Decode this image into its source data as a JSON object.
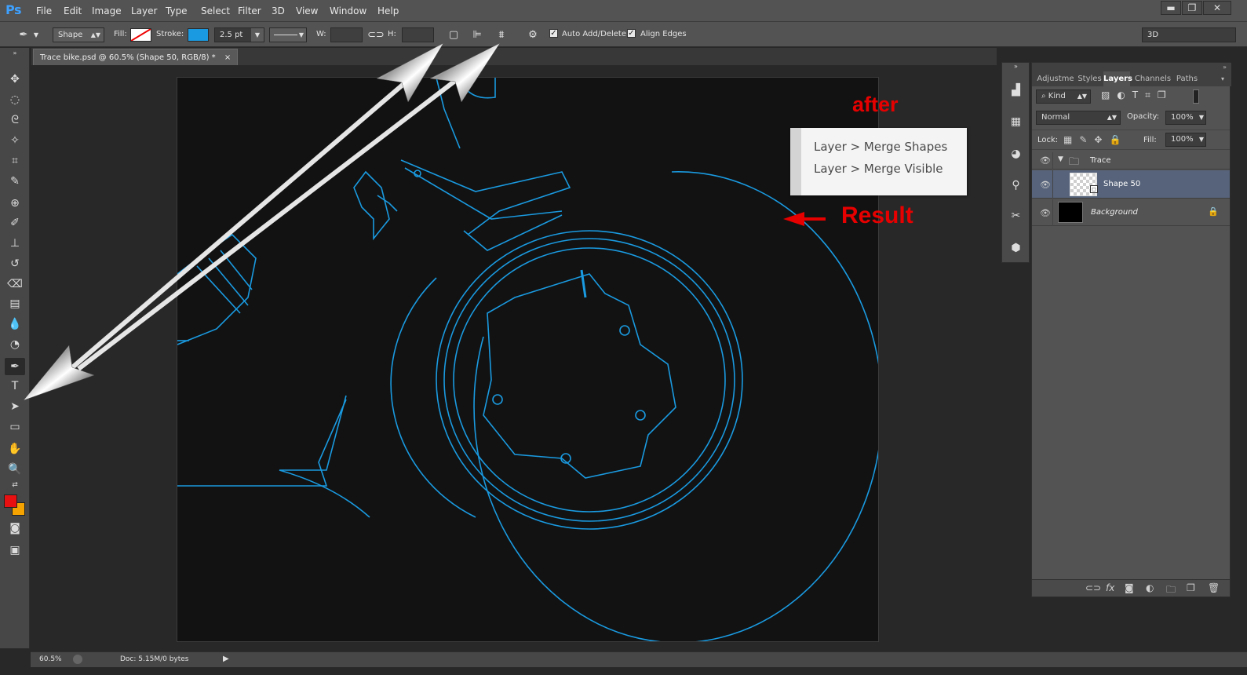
{
  "app": {
    "logo": "Ps"
  },
  "menu": [
    "File",
    "Edit",
    "Image",
    "Layer",
    "Type",
    "Select",
    "Filter",
    "3D",
    "View",
    "Window",
    "Help"
  ],
  "window_controls": {
    "minimize": "▬",
    "restore": "❐",
    "close": "✕"
  },
  "options": {
    "tool_mode": "Shape",
    "fill_label": "Fill:",
    "stroke_label": "Stroke:",
    "stroke_color": "#1a9ae0",
    "stroke_width": "2.5 pt",
    "w_label": "W:",
    "h_label": "H:",
    "auto_add_delete": "Auto Add/Delete",
    "align_edges": "Align Edges",
    "workspace": "3D"
  },
  "document": {
    "tab_title": "Trace bike.psd @ 60.5% (Shape 50, RGB/8) *",
    "close": "×"
  },
  "annotations": {
    "after": "after",
    "result": "Result",
    "merge_shapes": "Layer > Merge Shapes",
    "merge_visible": "Layer > Merge Visible"
  },
  "layers_panel": {
    "tabs": [
      "Adjustme",
      "Styles",
      "Layers",
      "Channels",
      "Paths"
    ],
    "active_tab": "Layers",
    "kind": "Kind",
    "blend_mode": "Normal",
    "opacity_label": "Opacity:",
    "opacity": "100%",
    "lock_label": "Lock:",
    "fill_label": "Fill:",
    "fill": "100%",
    "layers": [
      {
        "name": "Trace",
        "type": "group"
      },
      {
        "name": "Shape 50",
        "type": "shape"
      },
      {
        "name": "Background",
        "type": "background"
      }
    ]
  },
  "status": {
    "zoom": "60.5%",
    "doc": "Doc: 5.15M/0 bytes"
  },
  "colors": {
    "foreground": "#e81010",
    "background": "#f5a300",
    "accent": "#1a9ae0",
    "annotation": "#e60000"
  }
}
